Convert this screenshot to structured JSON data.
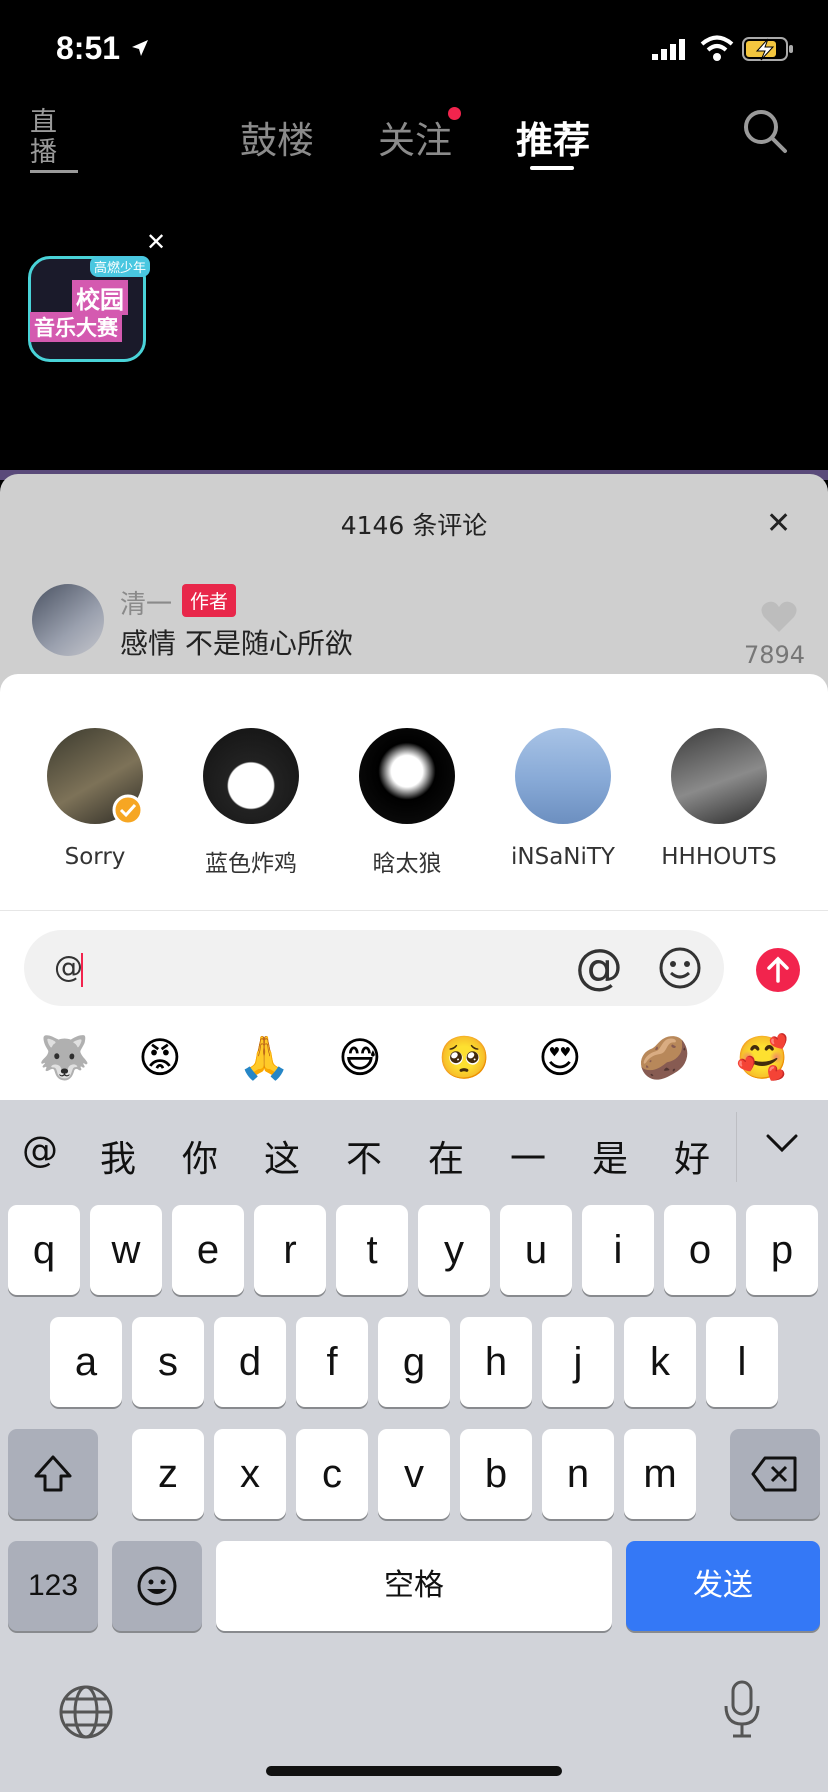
{
  "status_bar": {
    "time": "8:51"
  },
  "nav": {
    "live_icon_text": "直播",
    "tabs": [
      {
        "label": "鼓楼"
      },
      {
        "label": "关注"
      },
      {
        "label": "推荐"
      }
    ]
  },
  "promo": {
    "tag": "高燃少年",
    "line1": "校园",
    "line2": "音乐大赛"
  },
  "comments": {
    "count_label": "4146 条评论",
    "item": {
      "author": "清一",
      "badge": "作者",
      "text": "感情 不是随心所欲",
      "likes": "7894"
    }
  },
  "mention_users": [
    {
      "name": "Sorry"
    },
    {
      "name": "蓝色炸鸡"
    },
    {
      "name": "晗太狼"
    },
    {
      "name": "iNSaNiTY"
    },
    {
      "name": "HHHOUTS"
    }
  ],
  "input": {
    "value": "@"
  },
  "quick_emojis": [
    "🐺",
    "😡",
    "🙏",
    "😅",
    "🥺",
    "😍",
    "🥔",
    "🥰"
  ],
  "keyboard": {
    "candidates": [
      "@",
      "我",
      "你",
      "这",
      "不",
      "在",
      "一",
      "是",
      "好"
    ],
    "row1": [
      "q",
      "w",
      "e",
      "r",
      "t",
      "y",
      "u",
      "i",
      "o",
      "p"
    ],
    "row2": [
      "a",
      "s",
      "d",
      "f",
      "g",
      "h",
      "j",
      "k",
      "l"
    ],
    "row3": [
      "z",
      "x",
      "c",
      "v",
      "b",
      "n",
      "m"
    ],
    "numbers_label": "123",
    "space_label": "空格",
    "send_label": "发送"
  },
  "colors": {
    "accent": "#f2244d",
    "keyboard_send": "#3478f6"
  }
}
